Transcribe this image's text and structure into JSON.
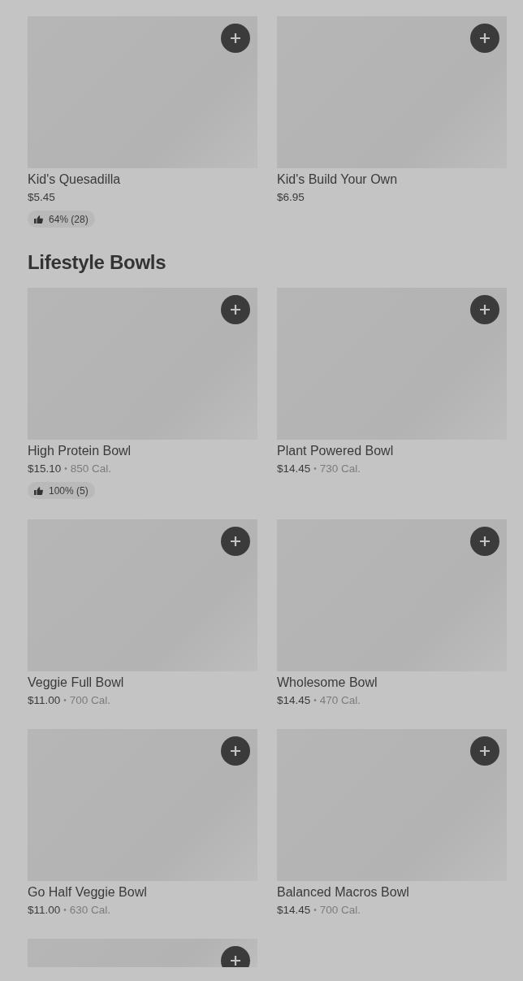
{
  "sections": [
    {
      "items": [
        {
          "name": "Kid's Quesadilla",
          "price": "$5.45",
          "rating": "64% (28)"
        },
        {
          "name": "Kid's Build Your Own",
          "price": "$6.95"
        }
      ]
    },
    {
      "title": "Lifestyle Bowls",
      "items": [
        {
          "name": "High Protein Bowl",
          "price": "$15.10",
          "separator": "•",
          "calories": "850 Cal.",
          "rating": "100% (5)"
        },
        {
          "name": "Plant Powered Bowl",
          "price": "$14.45",
          "separator": "•",
          "calories": "730 Cal."
        },
        {
          "name": "Veggie Full Bowl",
          "price": "$11.00",
          "separator": "•",
          "calories": "700 Cal."
        },
        {
          "name": "Wholesome Bowl",
          "price": "$14.45",
          "separator": "•",
          "calories": "470 Cal."
        },
        {
          "name": "Go Half Veggie Bowl",
          "price": "$11.00",
          "separator": "•",
          "calories": "630 Cal."
        },
        {
          "name": "Balanced Macros Bowl",
          "price": "$14.45",
          "separator": "•",
          "calories": "700 Cal."
        },
        {
          "kind": "cut_off"
        }
      ]
    }
  ]
}
